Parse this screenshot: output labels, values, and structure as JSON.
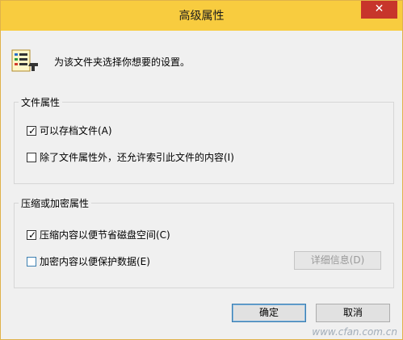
{
  "window": {
    "title": "高级属性",
    "close_symbol": "✕"
  },
  "header": {
    "description": "为该文件夹选择你想要的设置。"
  },
  "file_attributes": {
    "title": "文件属性",
    "options": [
      {
        "label": "可以存档文件(A)",
        "checked": true
      },
      {
        "label": "除了文件属性外，还允许索引此文件的内容(I)",
        "checked": false
      }
    ]
  },
  "compress_encrypt": {
    "title": "压缩或加密属性",
    "options": [
      {
        "label": "压缩内容以便节省磁盘空间(C)",
        "checked": true
      },
      {
        "label": "加密内容以便保护数据(E)",
        "checked": false
      }
    ],
    "details_button": "详细信息(D)"
  },
  "buttons": {
    "ok": "确定",
    "cancel": "取消"
  },
  "watermark": "www.cfan.com.cn",
  "colors": {
    "title_bar": "#f8cc3f",
    "close_button": "#c7352b",
    "focus_border": "#3c7fb1"
  }
}
